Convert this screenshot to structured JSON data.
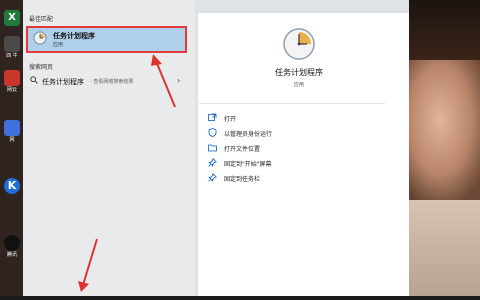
{
  "desktop": {
    "icons": [
      {
        "label": "",
        "color": "#1f7a3c",
        "glyph": "X"
      },
      {
        "label": "四 牛",
        "color": "#4a4a4a",
        "glyph": ""
      },
      {
        "label": "网云",
        "color": "#c9362b",
        "glyph": ""
      },
      {
        "label": "网",
        "color": "#3f6fd8",
        "glyph": ""
      },
      {
        "label": "",
        "color": "#1f6fd6",
        "glyph": "K"
      },
      {
        "label": "腾讯",
        "color": "#111111",
        "glyph": ""
      }
    ]
  },
  "start_menu": {
    "best_match_title": "最佳匹配",
    "best_match": {
      "name": "任务计划程序",
      "type": "应用"
    },
    "web_title": "搜索网页",
    "web_result": {
      "query": "任务计划程序",
      "hint": "- 查看网络搜索结果"
    },
    "detail": {
      "name": "任务计划程序",
      "type": "应用",
      "actions": [
        {
          "label": "打开",
          "icon": "open-icon"
        },
        {
          "label": "以管理员身份运行",
          "icon": "admin-shield-icon"
        },
        {
          "label": "打开文件位置",
          "icon": "folder-icon"
        },
        {
          "label": "固定到\"开始\"屏幕",
          "icon": "pin-icon"
        },
        {
          "label": "固定到任务栏",
          "icon": "pin-icon"
        }
      ]
    }
  },
  "colors": {
    "selection": "#aed0ea",
    "highlight_border": "#e03a3a",
    "accent": "#0a5cc2"
  }
}
